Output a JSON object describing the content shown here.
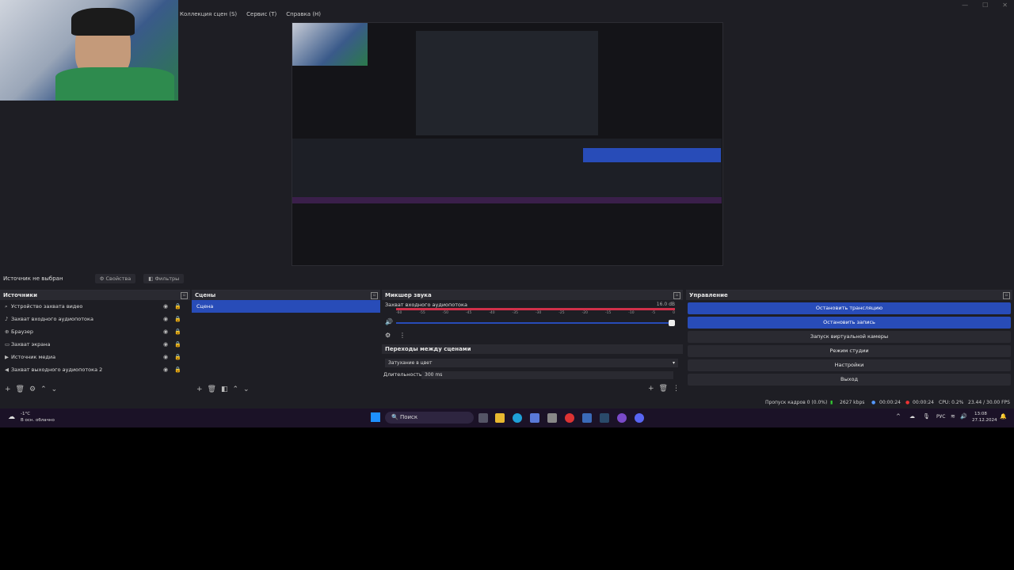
{
  "menubar": {
    "items": [
      "Коллекция сцен (S)",
      "Сервис (T)",
      "Справка (H)"
    ]
  },
  "window_controls": {
    "minimize": "—",
    "maximize": "☐",
    "close": "✕"
  },
  "source_bar": {
    "status": "Источник не выбран",
    "properties": "Свойства",
    "filters": "Фильтры"
  },
  "sources": {
    "title": "Источники",
    "items": [
      {
        "icon": "camera-icon",
        "label": "Устройство захвата видео"
      },
      {
        "icon": "mic-icon",
        "label": "Захват входного аудиопотока"
      },
      {
        "icon": "globe-icon",
        "label": "Браузер"
      },
      {
        "icon": "monitor-icon",
        "label": "Захват экрана"
      },
      {
        "icon": "play-icon",
        "label": "Источник медиа"
      },
      {
        "icon": "speaker-icon",
        "label": "Захват выходного аудиопотока 2"
      }
    ]
  },
  "scenes": {
    "title": "Сцены",
    "items": [
      "Сцена"
    ]
  },
  "mixer": {
    "title": "Микшер звука",
    "channel": "Захват входного аудиопотока",
    "level": "16.0 dB",
    "ticks": [
      "-60",
      "-55",
      "-50",
      "-45",
      "-40",
      "-35",
      "-30",
      "-25",
      "-20",
      "-15",
      "-10",
      "-5",
      "0"
    ]
  },
  "transitions": {
    "title": "Переходы между сценами",
    "selected": "Затухание в цвет",
    "duration_label": "Длительность",
    "duration_value": "300 ms"
  },
  "controls": {
    "title": "Управление",
    "buttons": [
      {
        "label": "Остановить трансляцию",
        "active": true
      },
      {
        "label": "Остановить запись",
        "active": true
      },
      {
        "label": "Запуск виртуальной камеры",
        "active": false
      },
      {
        "label": "Режим студии",
        "active": false
      },
      {
        "label": "Настройки",
        "active": false
      },
      {
        "label": "Выход",
        "active": false
      }
    ]
  },
  "statusbar": {
    "dropped": "Пропуск кадров 0 (0.0%)",
    "bitrate": "2627 kbps",
    "stream_time": "00:00:24",
    "rec_time": "00:00:24",
    "cpu": "CPU: 0.2%",
    "fps": "23.44 / 30.00 FPS"
  },
  "taskbar": {
    "weather_temp": "-1°C",
    "weather_desc": "В осн. облачно",
    "search": "Поиск",
    "lang": "РУС",
    "time": "13:08",
    "date": "27.12.2024"
  },
  "colors": {
    "accent": "#284cb8",
    "panel": "#1e1e24",
    "taskbar": "#1b1227",
    "meter": "#d0304a"
  }
}
